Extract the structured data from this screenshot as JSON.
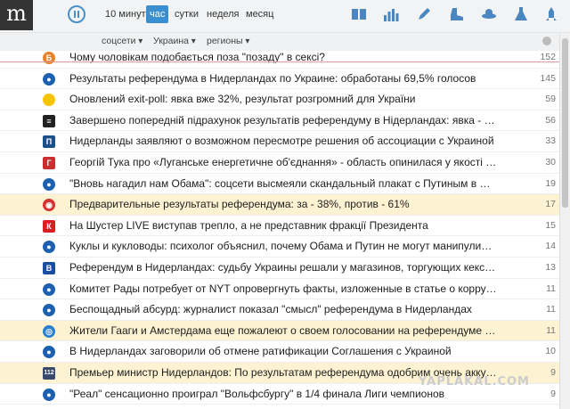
{
  "header": {
    "logo": "m",
    "periods": [
      "10 минут",
      "час",
      "сутки",
      "неделя",
      "месяц"
    ],
    "active_period": "час",
    "icons": [
      "newspaper-icon",
      "bar-chart-icon",
      "pen-icon",
      "boot-icon",
      "ufo-icon",
      "flask-icon",
      "rocket-icon"
    ]
  },
  "filters": [
    "соцсети",
    "Украина",
    "регионы"
  ],
  "items": [
    {
      "title": "Чому чоловікам подобається поза \"позаду\" в сексі?",
      "count": "152",
      "highlight": false,
      "icon": "Б",
      "color": "#e8822a"
    },
    {
      "title": "Результаты референдума в Нидерландах по Украине: обработаны 69,5% голосов",
      "count": "145",
      "highlight": false,
      "icon": "●",
      "color": "#1e60b0"
    },
    {
      "title": "Оновлений exit-poll: явка вже 32%, результат розгромний для України",
      "count": "59",
      "highlight": false,
      "icon": "",
      "color": "#f5c400"
    },
    {
      "title": "Завершено попередній підрахунок результатів референдуму в Нідерландах: явка - 32,2%, прот...",
      "count": "56",
      "highlight": false,
      "icon": "≡",
      "color": "#222222"
    },
    {
      "title": "Нидерланды заявляют о возможном пересмотре решения об ассоциации с Украиной",
      "count": "33",
      "highlight": false,
      "icon": "П",
      "color": "#1a4f8a"
    },
    {
      "title": "Георгій Тука про «Луганське енергетичне об'єднання» - область опинилася у якості заручника [...",
      "count": "30",
      "highlight": false,
      "icon": "Г",
      "color": "#c83030"
    },
    {
      "title": "\"Вновь нагадил нам Обама\": соцсети высмеяли скандальный плакат с Путиным в Москве",
      "count": "19",
      "highlight": false,
      "icon": "●",
      "color": "#1e60b0"
    },
    {
      "title": "Предварительные результаты референдума: за - 38%, против - 61%",
      "count": "17",
      "highlight": true,
      "icon": "◉",
      "color": "#d83030"
    },
    {
      "title": "На Шустер LIVE виступав трепло, а не представник фракції Президента",
      "count": "15",
      "highlight": false,
      "icon": "К",
      "color": "#d82020"
    },
    {
      "title": "Куклы и кукловоды: психолог объяснил, почему Обама и Путин не могут манипулировать укра...",
      "count": "14",
      "highlight": false,
      "icon": "●",
      "color": "#1e60b0"
    },
    {
      "title": "Референдум в Нидерландах: судьбу Украины решали у магазинов, торгующих кексами с травк...",
      "count": "13",
      "highlight": false,
      "icon": "В",
      "color": "#1a4fa0"
    },
    {
      "title": "Комитет Рады потребует от NYT опровергнуть факты, изложенные в статье о коррупции в Укр...",
      "count": "11",
      "highlight": false,
      "icon": "●",
      "color": "#1e60b0"
    },
    {
      "title": "Беспощадный абсурд: журналист показал \"смысл\" референдума в Нидерландах",
      "count": "11",
      "highlight": false,
      "icon": "●",
      "color": "#1e60b0"
    },
    {
      "title": "Жители Гааги и Амстердама еще пожалеют о своем голосовании на референдуме — Мустафа ...",
      "count": "11",
      "highlight": true,
      "icon": "◎",
      "color": "#2a7fd0"
    },
    {
      "title": "В Нидерландах заговорили об отмене ратификации Соглашения с Украиной",
      "count": "10",
      "highlight": false,
      "icon": "●",
      "color": "#1e60b0"
    },
    {
      "title": "Премьер министр Нидерландов: По результатам референдума одобрим очень аккуратное реш...",
      "count": "9",
      "highlight": true,
      "icon": "112",
      "color": "#3a4a6a"
    },
    {
      "title": "\"Реал\" сенсационно проиграл \"Вольфсбургу\" в 1/4 финала Лиги чемпионов",
      "count": "9",
      "highlight": false,
      "icon": "●",
      "color": "#1e60b0"
    }
  ],
  "watermark": "YAPLAKAL.COM"
}
